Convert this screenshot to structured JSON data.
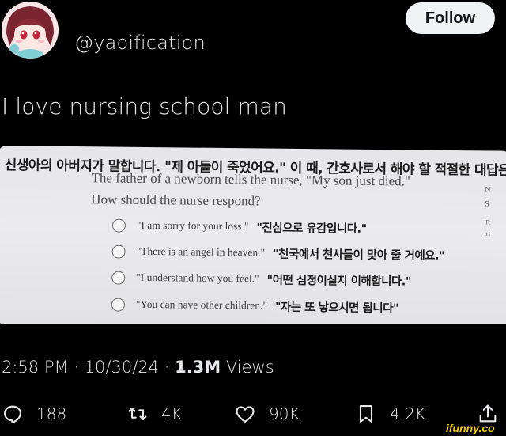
{
  "author": {
    "handle": "@yaoification",
    "avatar_icon": "anime-avatar"
  },
  "follow_label": "Follow",
  "tweet_text": "I love nursing school man",
  "media": {
    "korean_question": "신생아의 아버지가 말합니다. \"제 아들이 죽었어요.\" 이 때, 간호사로서 해야 할 적절한 대답은?",
    "question_line1": "The father of a newborn tells the nurse, \"My son just died.\"",
    "question_line2": "How should the nurse respond?",
    "options": [
      {
        "en": "\"I am sorry for your loss.\"",
        "ko": "\"진심으로 유감입니다.\""
      },
      {
        "en": "\"There is an angel in heaven.\"",
        "ko": "\"천국에서 천사들이 맞아 줄 거예요.\""
      },
      {
        "en": "\"I understand how you feel.\"",
        "ko": "\"어떤 심정이실지 이해합니다.\""
      },
      {
        "en": "\"You can have other children.\"",
        "ko": "\"자는 또 낳으시면 됩니다\""
      }
    ],
    "edge_fragments": [
      "N",
      "S",
      "Tc",
      "a :"
    ]
  },
  "meta": {
    "time": "2:58 PM",
    "sep": "·",
    "date": "10/30/24",
    "views_count": "1.3M",
    "views_label": "Views"
  },
  "actions": {
    "replies": "188",
    "retweets": "4K",
    "likes": "90K",
    "bookmarks": "4.2K"
  },
  "watermark": "ifunny.co",
  "colors": {
    "background": "#000000",
    "text": "#e7e9ea",
    "follow_bg": "#eff3f4",
    "watermark": "#f7d10b"
  }
}
